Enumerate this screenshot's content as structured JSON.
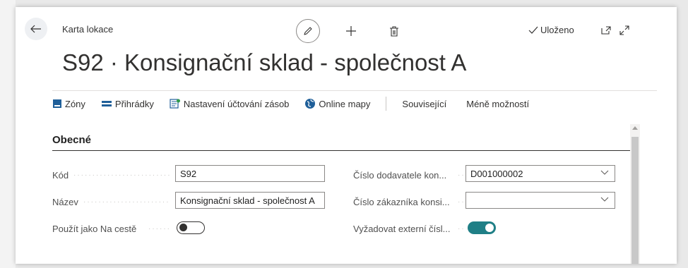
{
  "header": {
    "breadcrumb": "Karta lokace",
    "status": "Uloženo",
    "title": "S92 · Konsignační sklad - společnost A"
  },
  "actions": [
    {
      "label": "Zóny",
      "icon": "zones-icon"
    },
    {
      "label": "Přihrádky",
      "icon": "bins-icon"
    },
    {
      "label": "Nastavení účtování zásob",
      "icon": "inventory-posting-setup-icon"
    },
    {
      "label": "Online mapy",
      "icon": "online-map-icon"
    },
    {
      "label": "Související"
    },
    {
      "label": "Méně možností"
    }
  ],
  "section": {
    "title": "Obecné"
  },
  "fields": {
    "code": {
      "label": "Kód",
      "value": "S92"
    },
    "name": {
      "label": "Název",
      "value": "Konsignační sklad - společnost A"
    },
    "use_as_in_transit": {
      "label": "Použít jako Na cestě",
      "value": false
    },
    "vendor_no": {
      "label": "Číslo dodavatele kon...",
      "value": "D001000002"
    },
    "customer_no": {
      "label": "Číslo zákazníka konsi...",
      "value": ""
    },
    "require_external": {
      "label": "Vyžadovat externí čísl...",
      "value": true
    }
  },
  "colors": {
    "accent": "#1f7f86",
    "text": "#212121"
  }
}
